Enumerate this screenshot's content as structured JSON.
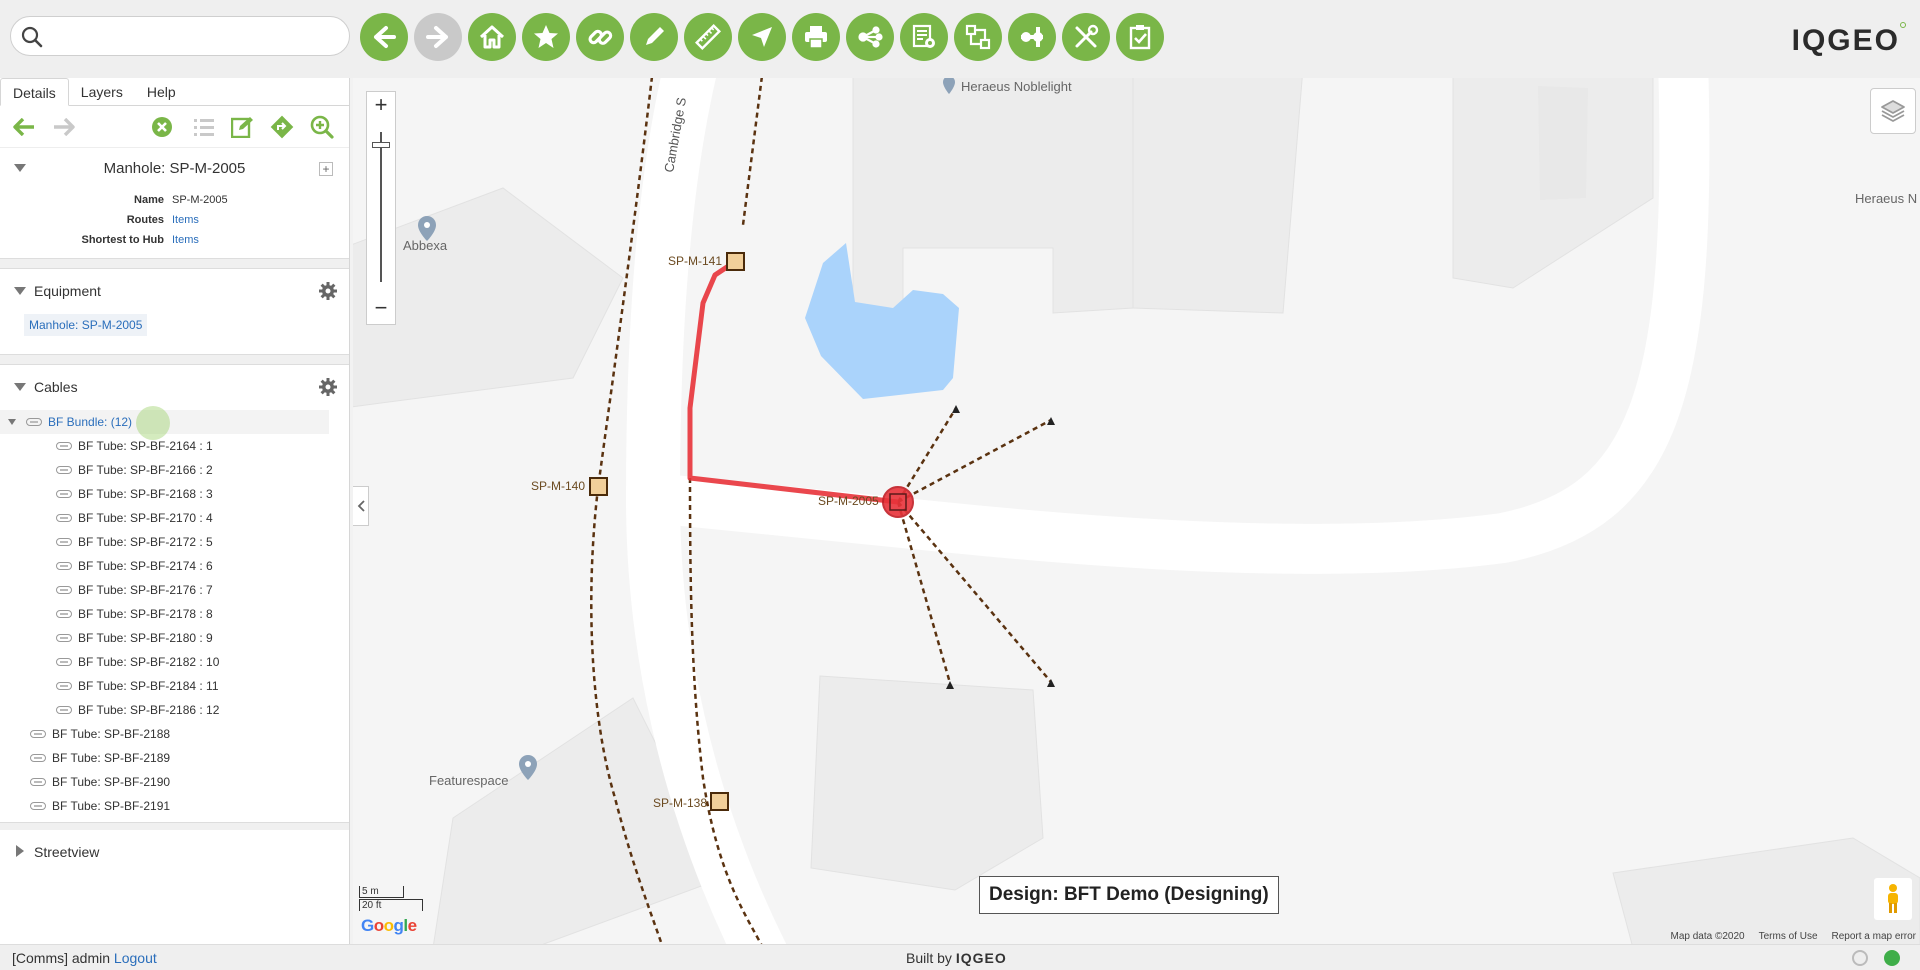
{
  "search": {
    "placeholder": "",
    "value": ""
  },
  "toolbar": {
    "buttons": [
      "back",
      "forward",
      "home",
      "bookmark",
      "link",
      "edit",
      "measure",
      "navigate",
      "print",
      "share",
      "settings-list",
      "network-trace",
      "connect",
      "tools",
      "checklist"
    ],
    "logo": "IQGEO"
  },
  "panel": {
    "tabs": [
      "Details",
      "Layers",
      "Help"
    ],
    "active_tab": "Details",
    "feature": {
      "title": "Manhole: SP-M-2005",
      "props": [
        {
          "key": "Name",
          "value": "SP-M-2005",
          "link": false
        },
        {
          "key": "Routes",
          "value": "Items",
          "link": true
        },
        {
          "key": "Shortest to Hub",
          "value": "Items",
          "link": true
        }
      ]
    },
    "equipment": {
      "title": "Equipment",
      "item": "Manhole: SP-M-2005"
    },
    "cables": {
      "title": "Cables",
      "bundle": "BF Bundle: (12)",
      "tubes": [
        "BF Tube: SP-BF-2164 : 1",
        "BF Tube: SP-BF-2166 : 2",
        "BF Tube: SP-BF-2168 : 3",
        "BF Tube: SP-BF-2170 : 4",
        "BF Tube: SP-BF-2172 : 5",
        "BF Tube: SP-BF-2174 : 6",
        "BF Tube: SP-BF-2176 : 7",
        "BF Tube: SP-BF-2178 : 8",
        "BF Tube: SP-BF-2180 : 9",
        "BF Tube: SP-BF-2182 : 10",
        "BF Tube: SP-BF-2184 : 11",
        "BF Tube: SP-BF-2186 : 12"
      ],
      "loose": [
        "BF Tube: SP-BF-2188",
        "BF Tube: SP-BF-2189",
        "BF Tube: SP-BF-2190",
        "BF Tube: SP-BF-2191"
      ]
    },
    "streetview": {
      "title": "Streetview"
    }
  },
  "map": {
    "road_label": "Cambridge S",
    "poi": [
      "Heraeus Noblelight",
      "Abbexa",
      "Featurespace",
      "Heraeus N"
    ],
    "manholes": [
      "SP-M-141",
      "SP-M-140",
      "SP-M-2005",
      "SP-M-138"
    ],
    "design_label": "Design: BFT Demo (Designing)",
    "scale": {
      "metric": "5 m",
      "imperial": "20 ft"
    },
    "google": "Google",
    "attribution": [
      "Map data ©2020",
      "Terms of Use",
      "Report a map error"
    ]
  },
  "status": {
    "user": "[Comms] admin",
    "logout": "Logout",
    "built_by": "Built by",
    "built_logo": "IQGEO"
  },
  "colors": {
    "accent": "#7ab648",
    "link": "#2a6ebb",
    "route": "#e8333a",
    "cable": "#5a3210",
    "manhole": "#f1cf9a"
  }
}
